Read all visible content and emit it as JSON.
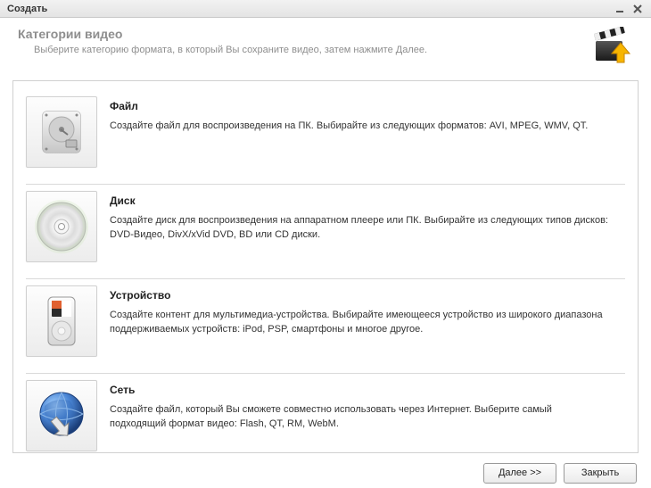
{
  "window": {
    "title": "Создать"
  },
  "header": {
    "title": "Категории видео",
    "subtitle": "Выберите категорию формата, в который Вы сохраните видео, затем нажмите Далее."
  },
  "categories": [
    {
      "icon": "hdd-icon",
      "title": "Файл",
      "desc": "Создайте файл для воспроизведения на ПК. Выбирайте из следующих форматов: AVI, MPEG, WMV, QT."
    },
    {
      "icon": "disc-icon",
      "title": "Диск",
      "desc": "Создайте диск для воспроизведения на аппаратном плеере или ПК. Выбирайте из следующих типов дисков: DVD-Видео, DivX/xVid DVD, BD или CD диски."
    },
    {
      "icon": "device-icon",
      "title": "Устройство",
      "desc": "Создайте контент для мультимедиа-устройства. Выбирайте имеющееся устройство из широкого диапазона поддерживаемых устройств: iPod, PSP, смартфоны и многое другое."
    },
    {
      "icon": "web-icon",
      "title": "Сеть",
      "desc": "Создайте файл, который Вы сможете совместно использовать через Интернет. Выберите самый подходящий формат видео: Flash, QT, RM, WebM."
    }
  ],
  "buttons": {
    "next": "Далее >>",
    "close": "Закрыть"
  }
}
